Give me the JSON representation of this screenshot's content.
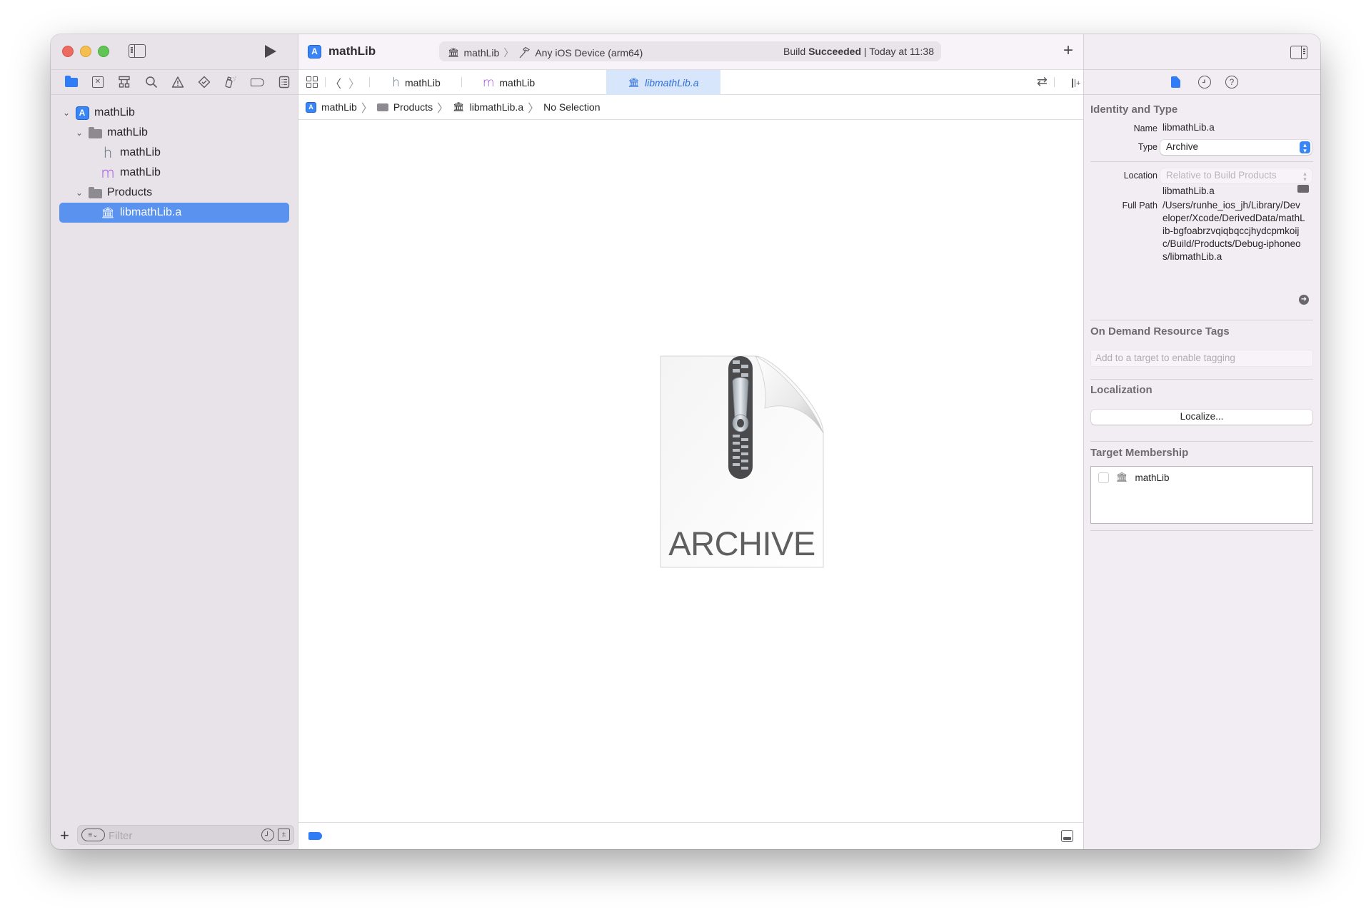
{
  "window": {
    "project_name": "mathLib",
    "scheme": {
      "target": "mathLib",
      "destination": "Any iOS Device (arm64)"
    },
    "status": {
      "prefix": "Build",
      "result": "Succeeded",
      "separator": "|",
      "time": "Today at 11:38"
    }
  },
  "navigator": {
    "tabs": [
      {
        "icon": "folder-icon",
        "active": true
      },
      {
        "icon": "source-control-icon"
      },
      {
        "icon": "symbol-hierarchy-icon"
      },
      {
        "icon": "search-icon"
      },
      {
        "icon": "warning-icon"
      },
      {
        "icon": "test-icon"
      },
      {
        "icon": "debug-spray-icon"
      },
      {
        "icon": "breakpoint-icon"
      },
      {
        "icon": "report-icon"
      }
    ],
    "tree": [
      {
        "label": "mathLib",
        "icon": "app-project-icon",
        "level": 0,
        "expanded": true
      },
      {
        "label": "mathLib",
        "icon": "folder-icon",
        "level": 1,
        "expanded": true
      },
      {
        "label": "mathLib",
        "icon": "h",
        "level": 2
      },
      {
        "label": "mathLib",
        "icon": "m",
        "level": 2
      },
      {
        "label": "Products",
        "icon": "folder-icon",
        "level": 1,
        "expanded": true
      },
      {
        "label": "libmathLib.a",
        "icon": "library-icon",
        "level": 2,
        "selected": true
      }
    ],
    "filter": {
      "placeholder": "Filter",
      "value": ""
    }
  },
  "editor": {
    "tabs": [
      {
        "glyph": "h",
        "label": "mathLib",
        "active": false
      },
      {
        "glyph": "m",
        "label": "mathLib",
        "active": false
      },
      {
        "glyph": "library",
        "label": "libmathLib.a",
        "active": true
      }
    ],
    "jump_bar": [
      "mathLib",
      "Products",
      "libmathLib.a",
      "No Selection"
    ],
    "preview_label": "ARCHIVE",
    "glyphs": {
      "h": "h",
      "m": "m",
      "library": "🏛",
      "chevron_down": "⌄",
      "chevron_right": "〉",
      "back": "〈",
      "forward": "〉",
      "swap": "⇄",
      "add": "+",
      "app": "A",
      "question": "?",
      "arrow_right": "➜"
    }
  },
  "inspector": {
    "identity": {
      "title": "Identity and Type",
      "name_label": "Name",
      "name_value": "libmathLib.a",
      "type_label": "Type",
      "type_value": "Archive",
      "location_label": "Location",
      "location_value": "Relative to Build Products",
      "location_file": "libmathLib.a",
      "full_path_label": "Full Path",
      "full_path_value": "/Users/runhe_ios_jh/Library/Developer/Xcode/DerivedData/mathLib-bgfoabrzvqiqbqccjhydcpmkoijc/Build/Products/Debug-iphoneos/libmathLib.a"
    },
    "on_demand": {
      "title": "On Demand Resource Tags",
      "placeholder": "Add to a target to enable tagging"
    },
    "localization": {
      "title": "Localization",
      "button": "Localize..."
    },
    "target_membership": {
      "title": "Target Membership",
      "targets": [
        {
          "name": "mathLib",
          "checked": false
        }
      ]
    }
  }
}
